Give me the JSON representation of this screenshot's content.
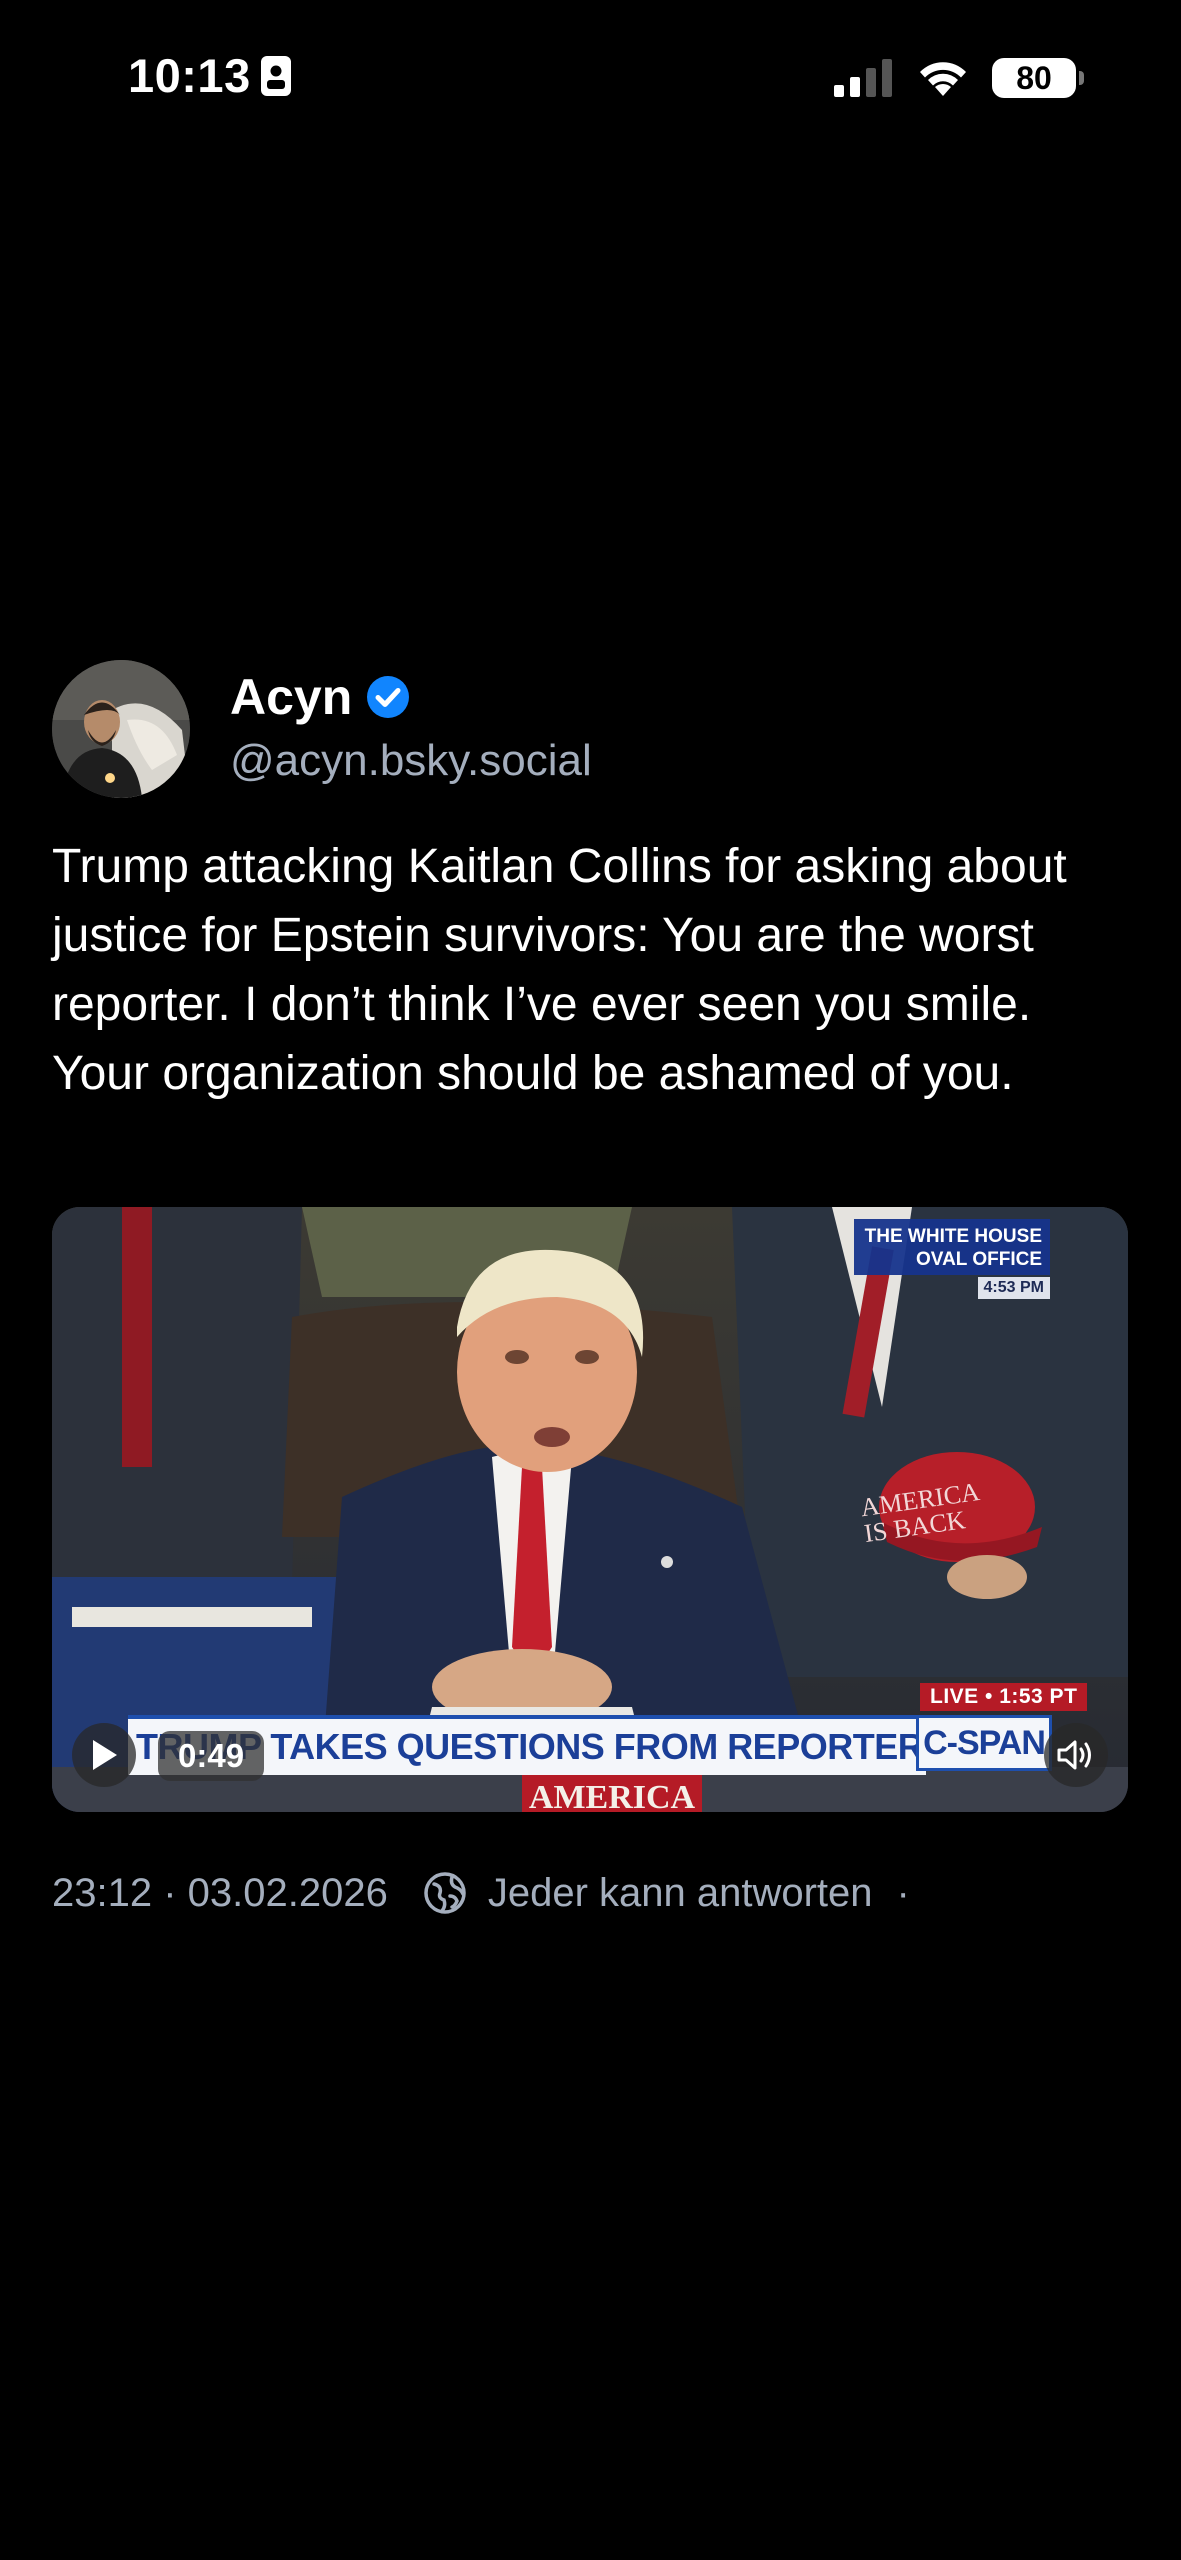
{
  "status_bar": {
    "time": "10:13",
    "battery": "80"
  },
  "post": {
    "author_name": "Acyn",
    "author_handle": "@acyn.bsky.social",
    "text": "Trump attacking Kaitlan Collins for asking about justice for Epstein survivors: You are the worst reporter. I don’t think I’ve ever seen you smile. Your organization should be ashamed of you.",
    "video": {
      "duration": "0:49",
      "overlay_tag_line1": "THE WHITE HOUSE",
      "overlay_tag_line2": "OVAL OFFICE",
      "overlay_tag_time": "4:53 PM",
      "hat_text": "AMERICA IS BACK",
      "live_tag": "LIVE • 1:53 PT",
      "chyron": "TRUMP TAKES QUESTIONS FROM REPORTERS",
      "network": "C-SPAN",
      "banner": "AMERICA"
    },
    "meta": {
      "timestamp": "23:12 · 03.02.2026",
      "reply_setting": "Jeder kann antworten",
      "trailing_dot": "·"
    }
  },
  "colors": {
    "background": "#000000",
    "handle_gray": "#a4aebd",
    "verified_blue": "#1185fe"
  }
}
